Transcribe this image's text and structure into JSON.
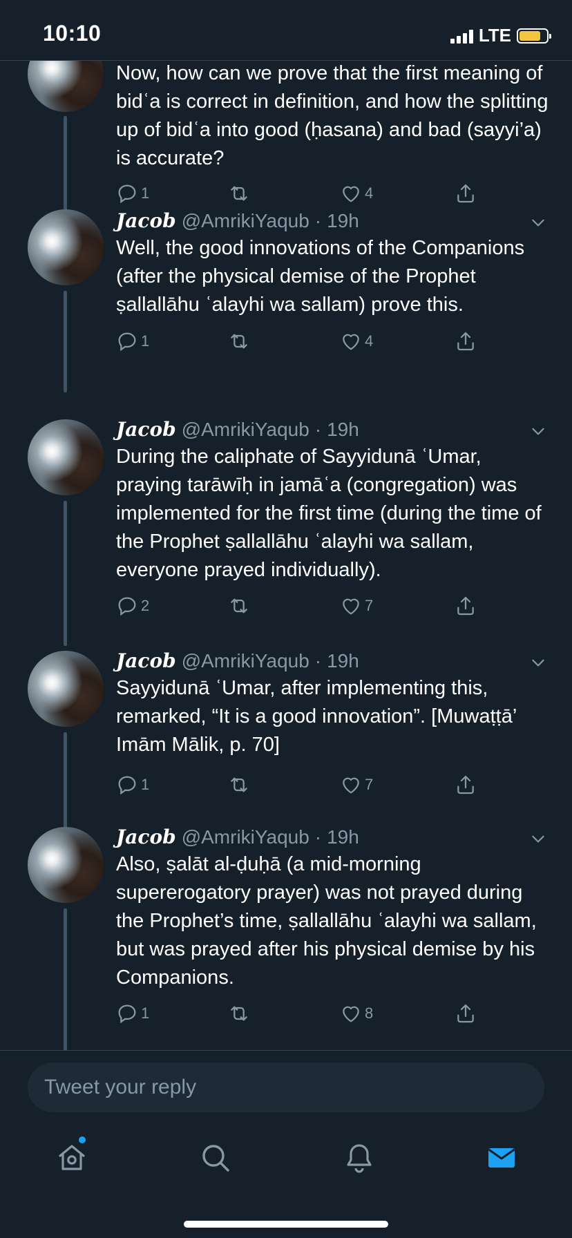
{
  "status_bar": {
    "time": "10:10",
    "network": "LTE",
    "battery_color": "#f5c542"
  },
  "tweets": [
    {
      "name": "",
      "handle": "",
      "time": "",
      "text": "Now, how can we prove that the first meaning of bidʿa is correct in definition, and how the splitting up of bidʿa into good (ḥasana) and bad (sayyi’a) is accurate?",
      "replies": "1",
      "retweets": "",
      "likes": "4"
    },
    {
      "name": "Jacob",
      "handle": "@AmrikiYaqub",
      "time": "19h",
      "text": "Well, the good innovations of the Companions (after the physical demise of the Prophet ṣallallāhu ʿalayhi wa sallam) prove this.",
      "replies": "1",
      "retweets": "",
      "likes": "4"
    },
    {
      "name": "Jacob",
      "handle": "@AmrikiYaqub",
      "time": "19h",
      "text": "During the caliphate of Sayyidunā ʿUmar, praying tarāwīḥ in jamāʿa (congregation) was implemented for the first time (during the time of the Prophet ṣallallāhu ʿalayhi wa sallam, everyone prayed individually).",
      "replies": "2",
      "retweets": "",
      "likes": "7"
    },
    {
      "name": "Jacob",
      "handle": "@AmrikiYaqub",
      "time": "19h",
      "text": "Sayyidunā ʿUmar, after implementing this, remarked, “It is a good innovation”. [Muwaṭṭā’ Imām Mālik, p. 70]",
      "replies": "1",
      "retweets": "",
      "likes": "7"
    },
    {
      "name": "Jacob",
      "handle": "@AmrikiYaqub",
      "time": "19h",
      "text": "Also, ṣalāt al-ḍuḥā (a mid-morning supererogatory prayer) was not prayed during the Prophet’s time, ṣallallāhu ʿalayhi wa sallam, but was prayed after his physical demise by his Companions.",
      "replies": "1",
      "retweets": "",
      "likes": "8"
    }
  ],
  "reply": {
    "placeholder": "Tweet your reply"
  },
  "tab_bar": {
    "active_color": "#1da1f2",
    "icons": [
      "home-icon",
      "search-icon",
      "bell-icon",
      "mail-icon"
    ]
  }
}
